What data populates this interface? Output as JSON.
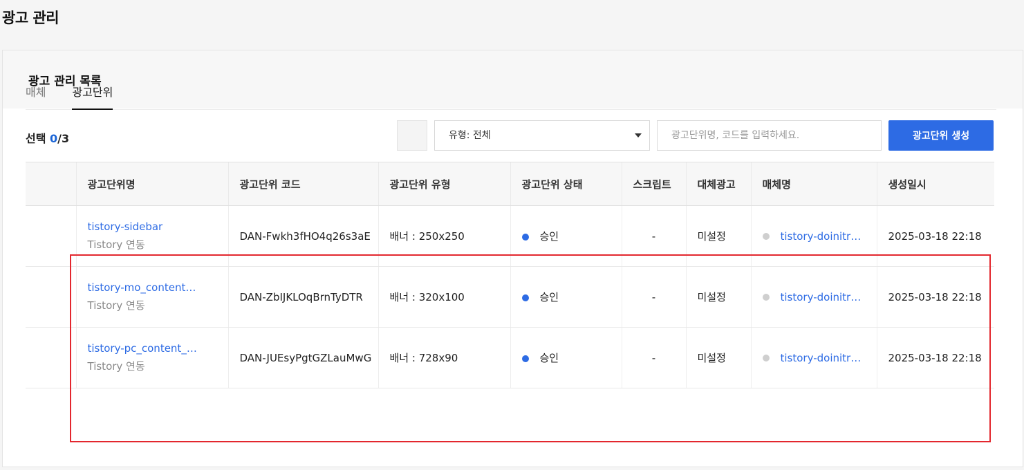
{
  "page": {
    "title": "광고 관리"
  },
  "card": {
    "title": "광고 관리 목록"
  },
  "tabs": [
    {
      "label": "매체",
      "active": false
    },
    {
      "label": "광고단위",
      "active": true
    }
  ],
  "toolbar": {
    "select_prefix": "선택 ",
    "select_count": "0",
    "select_total": "/3",
    "type_select_value": "유형: 전체",
    "search_placeholder": "광고단위명, 코드를 입력하세요.",
    "create_button": "광고단위 생성"
  },
  "table": {
    "columns": [
      "",
      "광고단위명",
      "광고단위 코드",
      "광고단위 유형",
      "광고단위 상태",
      "스크립트",
      "대체광고",
      "매체명",
      "생성일시"
    ],
    "rows": [
      {
        "name": "tistory-sidebar",
        "sub": "Tistory 연동",
        "code": "DAN-Fwkh3fHO4q26s3aE",
        "type": "배너 : 250x250",
        "status": "승인",
        "script": "-",
        "fallback": "미설정",
        "media": "tistory-doinitr…",
        "created": "2025-03-18 22:18"
      },
      {
        "name": "tistory-mo_content…",
        "sub": "Tistory 연동",
        "code": "DAN-ZbIJKLOqBrnTyDTR",
        "type": "배너 : 320x100",
        "status": "승인",
        "script": "-",
        "fallback": "미설정",
        "media": "tistory-doinitr…",
        "created": "2025-03-18 22:18"
      },
      {
        "name": "tistory-pc_content_…",
        "sub": "Tistory 연동",
        "code": "DAN-JUEsyPgtGZLauMwG",
        "type": "배너 : 728x90",
        "status": "승인",
        "script": "-",
        "fallback": "미설정",
        "media": "tistory-doinitr…",
        "created": "2025-03-18 22:18"
      }
    ]
  },
  "colors": {
    "accent": "#2d6be4",
    "highlight": "#e3272e",
    "status_approved": "#2d6be4",
    "media_dot": "#cfcfcf"
  }
}
